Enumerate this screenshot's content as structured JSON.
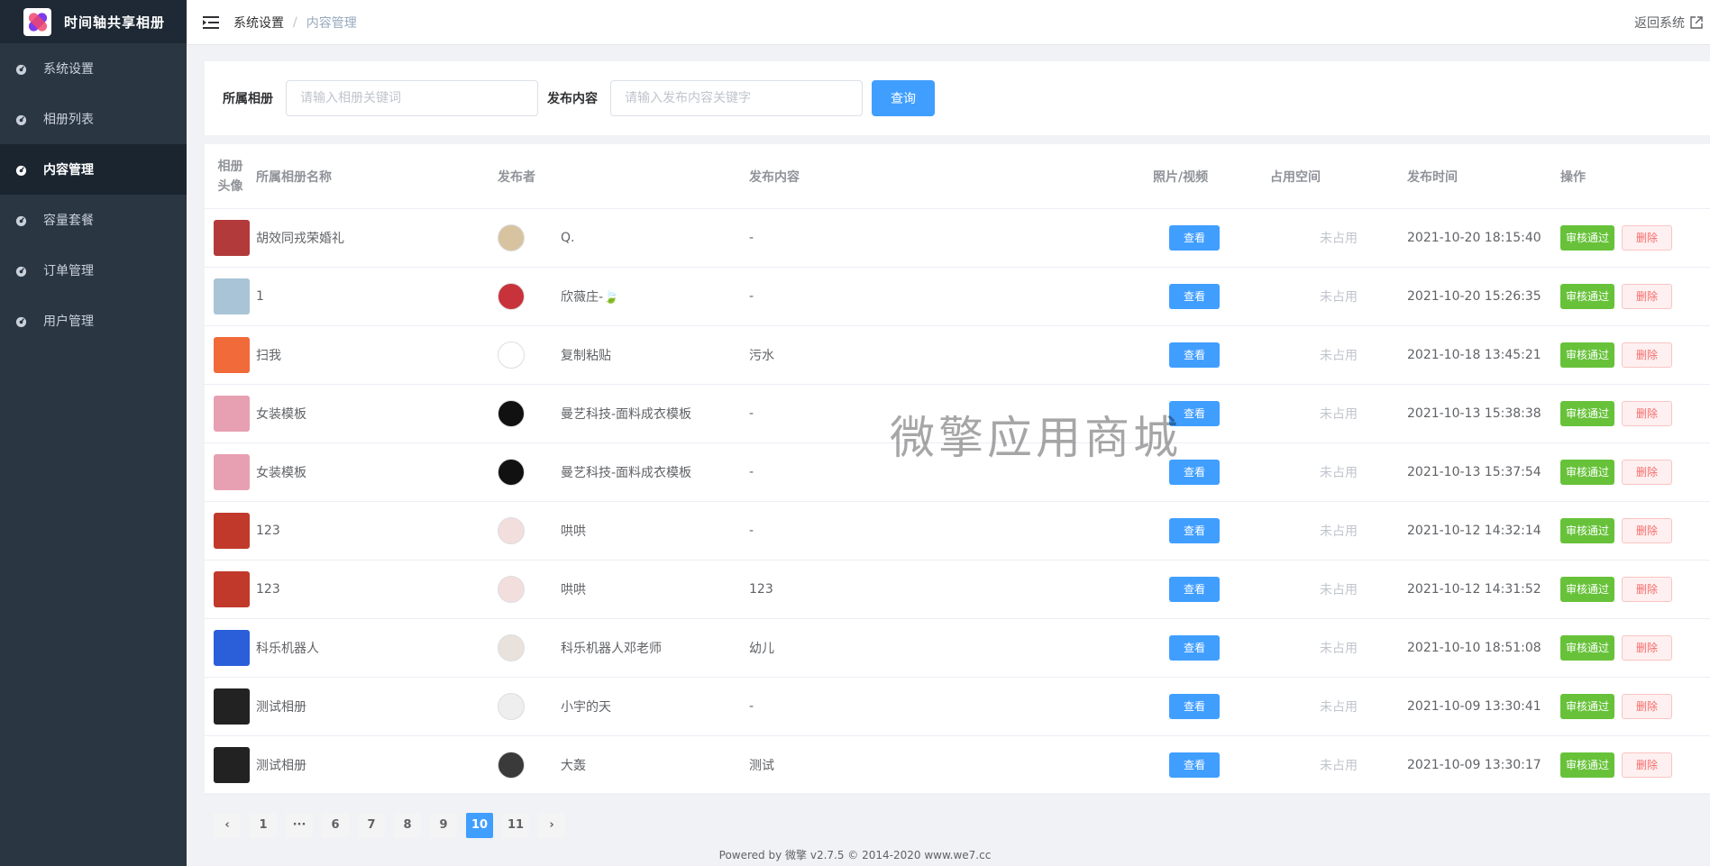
{
  "app": {
    "title": "时间轴共享相册"
  },
  "sidebar": {
    "items": [
      {
        "label": "系统设置",
        "icon": "dashboard-icon"
      },
      {
        "label": "相册列表",
        "icon": "dashboard-icon"
      },
      {
        "label": "内容管理",
        "icon": "dashboard-icon",
        "active": true
      },
      {
        "label": "容量套餐",
        "icon": "dashboard-icon"
      },
      {
        "label": "订单管理",
        "icon": "dashboard-icon"
      },
      {
        "label": "用户管理",
        "icon": "dashboard-icon"
      }
    ]
  },
  "header": {
    "breadcrumb": [
      "系统设置",
      "内容管理"
    ],
    "separator": "/",
    "back_label": "返回系统"
  },
  "filter": {
    "album_label": "所属相册",
    "album_placeholder": "请输入相册关键词",
    "content_label": "发布内容",
    "content_placeholder": "请输入发布内容关键字",
    "query_label": "查询"
  },
  "table": {
    "columns": [
      "相册头像",
      "所属相册名称",
      "发布者",
      "发布内容",
      "照片/视频",
      "占用空间",
      "发布时间",
      "操作"
    ],
    "column0_line1": "相册",
    "column0_line2": "头像",
    "view_label": "查看",
    "pass_label": "审核通过",
    "delete_label": "删除",
    "rows": [
      {
        "album": "胡效同戎荣婚礼",
        "publisher": "Q.",
        "content": "-",
        "space": "未占用",
        "time": "2021-10-20 18:15:40",
        "thumb_color": "#b23a3a",
        "avatar_color": "#d8c3a0"
      },
      {
        "album": "1",
        "publisher": "欣薇庄-🍃",
        "content": "-",
        "space": "未占用",
        "time": "2021-10-20 15:26:35",
        "thumb_color": "#a9c4d6",
        "avatar_color": "#c8323a"
      },
      {
        "album": "扫我",
        "publisher": "复制粘贴",
        "content": "污水",
        "space": "未占用",
        "time": "2021-10-18 13:45:21",
        "thumb_color": "#f06a3a",
        "avatar_color": "#ffffff"
      },
      {
        "album": "女装模板",
        "publisher": "曼艺科技-面料成衣模板",
        "content": "-",
        "space": "未占用",
        "time": "2021-10-13 15:38:38",
        "thumb_color": "#e7a0b2",
        "avatar_color": "#111111"
      },
      {
        "album": "女装模板",
        "publisher": "曼艺科技-面料成衣模板",
        "content": "-",
        "space": "未占用",
        "time": "2021-10-13 15:37:54",
        "thumb_color": "#e7a0b2",
        "avatar_color": "#111111"
      },
      {
        "album": "123",
        "publisher": "哄哄",
        "content": "-",
        "space": "未占用",
        "time": "2021-10-12 14:32:14",
        "thumb_color": "#c0392b",
        "avatar_color": "#f3dede"
      },
      {
        "album": "123",
        "publisher": "哄哄",
        "content": "123",
        "space": "未占用",
        "time": "2021-10-12 14:31:52",
        "thumb_color": "#c0392b",
        "avatar_color": "#f3dede"
      },
      {
        "album": "科乐机器人",
        "publisher": "科乐机器人邓老师",
        "content": "幼儿",
        "space": "未占用",
        "time": "2021-10-10 18:51:08",
        "thumb_color": "#2b5fd9",
        "avatar_color": "#e9e2dc"
      },
      {
        "album": "测试相册",
        "publisher": "小宇的天",
        "content": "-",
        "space": "未占用",
        "time": "2021-10-09 13:30:41",
        "thumb_color": "#222222",
        "avatar_color": "#eeeeee"
      },
      {
        "album": "测试相册",
        "publisher": "大轰",
        "content": "测试",
        "space": "未占用",
        "time": "2021-10-09 13:30:17",
        "thumb_color": "#222222",
        "avatar_color": "#3a3a3a"
      }
    ]
  },
  "pagination": {
    "prev": "‹",
    "next": "›",
    "pages": [
      "1",
      "···",
      "6",
      "7",
      "8",
      "9",
      "10",
      "11"
    ],
    "current": "10"
  },
  "footer": {
    "text": "Powered by 微擎 v2.7.5 © 2014-2020 www.we7.cc"
  },
  "watermark": {
    "text": "微擎应用商城"
  },
  "colors": {
    "primary": "#409eff",
    "success": "#67c23a",
    "danger": "#f56c6c",
    "sidebar": "#2b3643"
  }
}
